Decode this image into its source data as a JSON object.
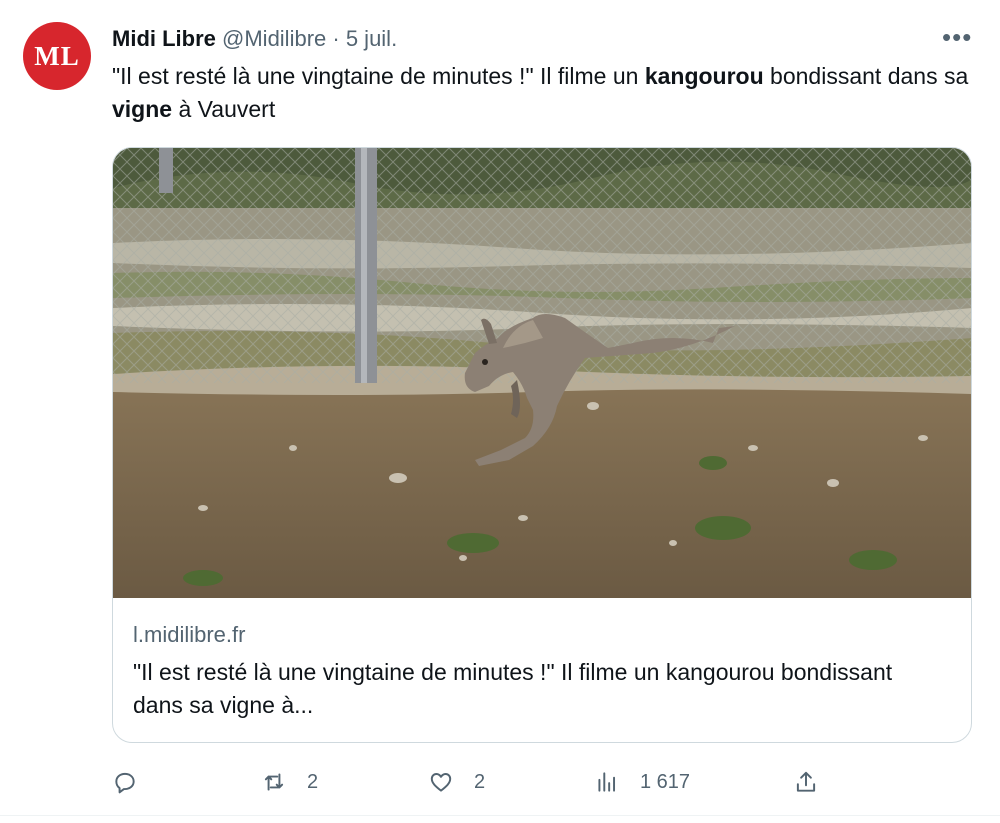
{
  "tweet": {
    "avatar_text": "ML",
    "author_name": "Midi Libre",
    "handle": "@Midilibre",
    "separator": " · ",
    "date": "5 juil.",
    "more_label": "•••",
    "text_parts": {
      "t1": "\"Il est resté là une vingtaine de minutes !\" Il filme un ",
      "b1": "kangourou",
      "t2": " bondissant dans sa ",
      "b2": "vigne",
      "t3": " à Vauvert"
    }
  },
  "card": {
    "domain": "l.midilibre.fr",
    "title": "\"Il est resté là une vingtaine de minutes !\" Il filme un kangourou bondissant dans sa vigne à..."
  },
  "actions": {
    "reply_count": "",
    "retweet_count": "2",
    "like_count": "2",
    "views_count": "1 617"
  },
  "colors": {
    "avatar_bg": "#d7262d",
    "text": "#0f1419",
    "muted": "#536471",
    "border": "#cfd9de"
  }
}
